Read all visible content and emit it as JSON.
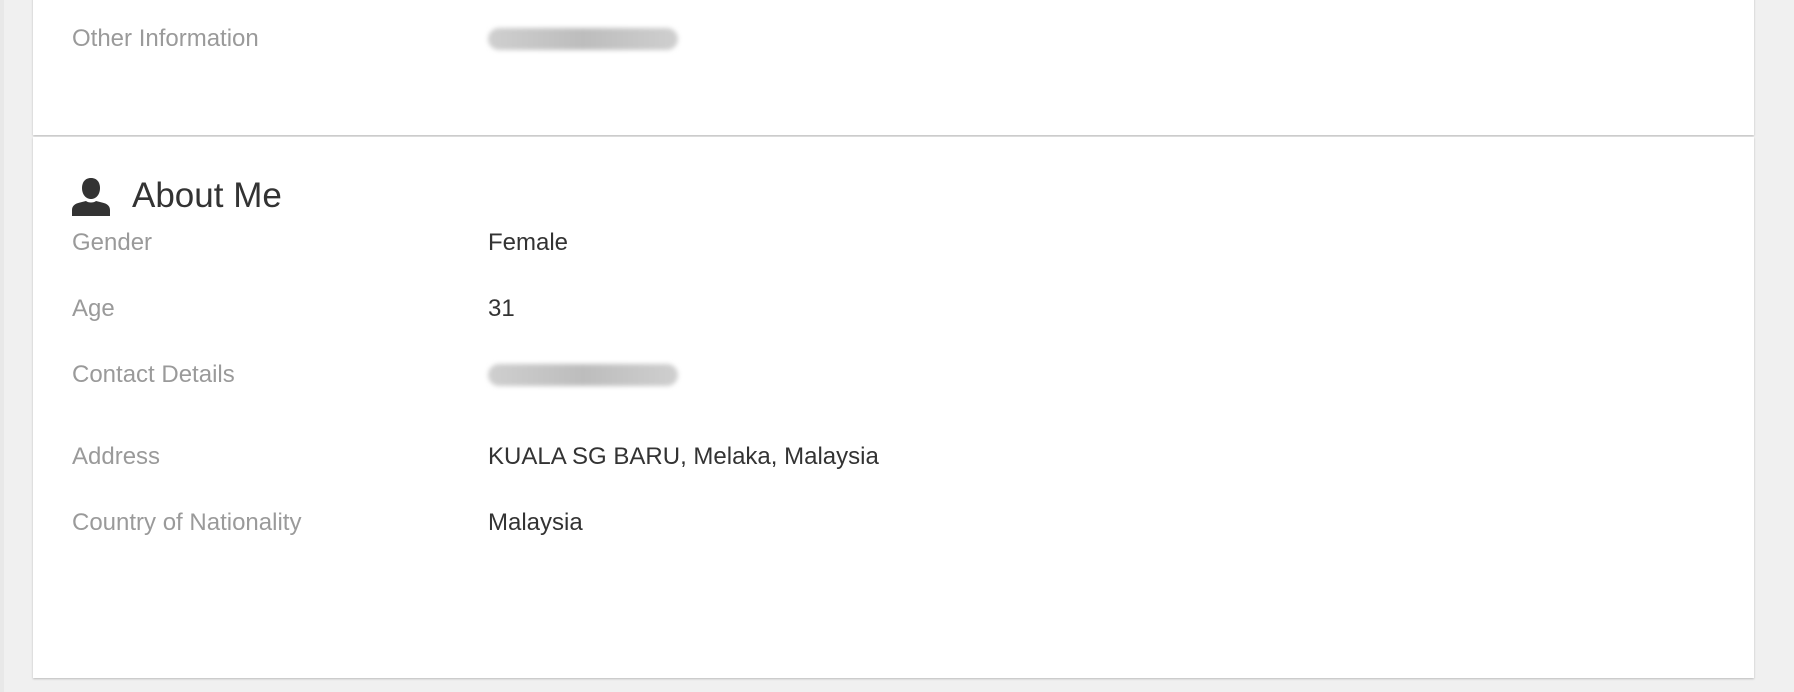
{
  "other_section": {
    "rows": [
      {
        "label": "Other Information",
        "value": ""
      }
    ]
  },
  "about_me": {
    "title": "About Me",
    "icon": "user-icon",
    "rows": [
      {
        "label": "Gender",
        "value": "Female"
      },
      {
        "label": "Age",
        "value": "31"
      },
      {
        "label": "Contact Details",
        "value": ""
      },
      {
        "label": "Address",
        "value": "KUALA SG BARU, Melaka, Malaysia"
      },
      {
        "label": "Country of Nationality",
        "value": "Malaysia"
      }
    ]
  },
  "colors": {
    "background": "#f0f0f0",
    "card": "#ffffff",
    "label": "#9a9a9a",
    "value": "#333333",
    "icon": "#333333"
  }
}
